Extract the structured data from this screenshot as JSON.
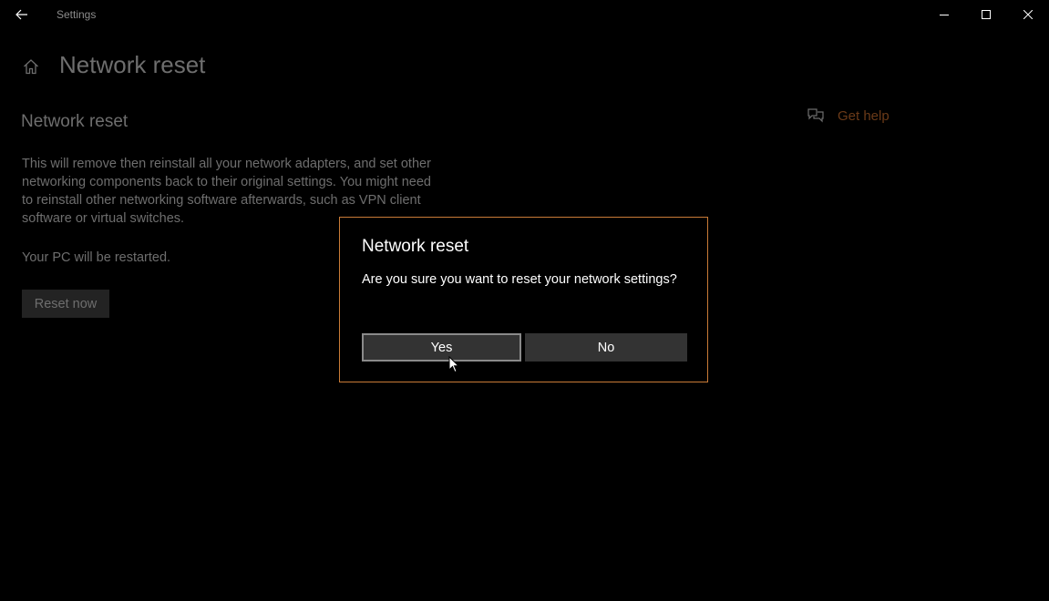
{
  "window": {
    "title": "Settings",
    "icons": {
      "back": "back-arrow-icon",
      "minimize": "minimize-icon",
      "maximize": "maximize-icon",
      "close": "close-icon"
    }
  },
  "header": {
    "home_icon": "home-icon",
    "title": "Network reset"
  },
  "main": {
    "section_title": "Network reset",
    "description": "This will remove then reinstall all your network adapters, and set other networking components back to their original settings. You might need to reinstall other networking software afterwards, such as VPN client software or virtual switches.",
    "restart_note": "Your PC will be restarted.",
    "reset_button_label": "Reset now"
  },
  "help": {
    "icon": "chat-help-icon",
    "label": "Get help"
  },
  "dialog": {
    "title": "Network reset",
    "message": "Are you sure you want to reset your network settings?",
    "yes_label": "Yes",
    "no_label": "No"
  },
  "colors": {
    "background": "#000000",
    "text_primary": "#ffffff",
    "text_dimmed": "#6e6e6e",
    "accent_border": "#c97b37",
    "help_link": "#6b3a18",
    "button_bg": "#333333"
  }
}
